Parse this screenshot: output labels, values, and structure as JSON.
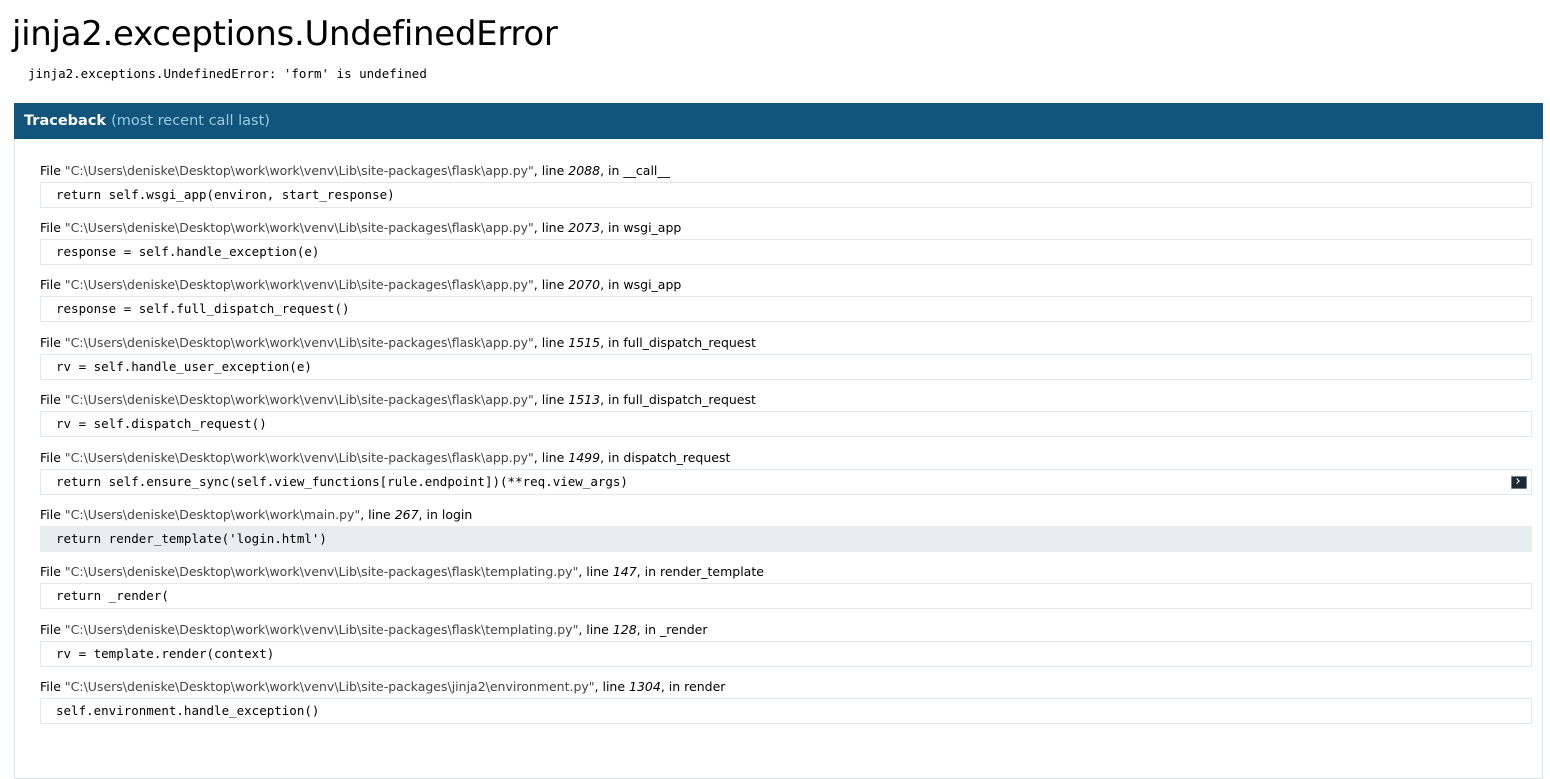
{
  "page": {
    "title": "jinja2.exceptions.UndefinedError",
    "error_message": "jinja2.exceptions.UndefinedError: 'form' is undefined"
  },
  "traceback": {
    "header_label": "Traceback",
    "header_note": "(most recent call last)",
    "file_prefix": "File ",
    "line_prefix": ", line ",
    "in_prefix": ", in ",
    "frames": [
      {
        "file": "\"C:\\Users\\deniske\\Desktop\\work\\work\\venv\\Lib\\site-packages\\flask\\app.py\"",
        "line": "2088",
        "func": "__call__",
        "code": "return self.wsgi_app(environ, start_response)"
      },
      {
        "file": "\"C:\\Users\\deniske\\Desktop\\work\\work\\venv\\Lib\\site-packages\\flask\\app.py\"",
        "line": "2073",
        "func": "wsgi_app",
        "code": "response = self.handle_exception(e)"
      },
      {
        "file": "\"C:\\Users\\deniske\\Desktop\\work\\work\\venv\\Lib\\site-packages\\flask\\app.py\"",
        "line": "2070",
        "func": "wsgi_app",
        "code": "response = self.full_dispatch_request()"
      },
      {
        "file": "\"C:\\Users\\deniske\\Desktop\\work\\work\\venv\\Lib\\site-packages\\flask\\app.py\"",
        "line": "1515",
        "func": "full_dispatch_request",
        "code": "rv = self.handle_user_exception(e)"
      },
      {
        "file": "\"C:\\Users\\deniske\\Desktop\\work\\work\\venv\\Lib\\site-packages\\flask\\app.py\"",
        "line": "1513",
        "func": "full_dispatch_request",
        "code": "rv = self.dispatch_request()"
      },
      {
        "file": "\"C:\\Users\\deniske\\Desktop\\work\\work\\venv\\Lib\\site-packages\\flask\\app.py\"",
        "line": "1499",
        "func": "dispatch_request",
        "code": "return self.ensure_sync(self.view_functions[rule.endpoint])(**req.view_args)"
      },
      {
        "file": "\"C:\\Users\\deniske\\Desktop\\work\\work\\main.py\"",
        "line": "267",
        "func": "login",
        "code": "return render_template('login.html')"
      },
      {
        "file": "\"C:\\Users\\deniske\\Desktop\\work\\work\\venv\\Lib\\site-packages\\flask\\templating.py\"",
        "line": "147",
        "func": "render_template",
        "code": "return _render("
      },
      {
        "file": "\"C:\\Users\\deniske\\Desktop\\work\\work\\venv\\Lib\\site-packages\\flask\\templating.py\"",
        "line": "128",
        "func": "_render",
        "code": "rv = template.render(context)"
      },
      {
        "file": "\"C:\\Users\\deniske\\Desktop\\work\\work\\venv\\Lib\\site-packages\\jinja2\\environment.py\"",
        "line": "1304",
        "func": "render",
        "code": "self.environment.handle_exception()"
      }
    ]
  },
  "icons": {
    "console": "console-icon"
  },
  "colors": {
    "header_bg": "#11557c",
    "header_note": "#9ccbe1",
    "current_line_bg": "#e6eef0"
  }
}
